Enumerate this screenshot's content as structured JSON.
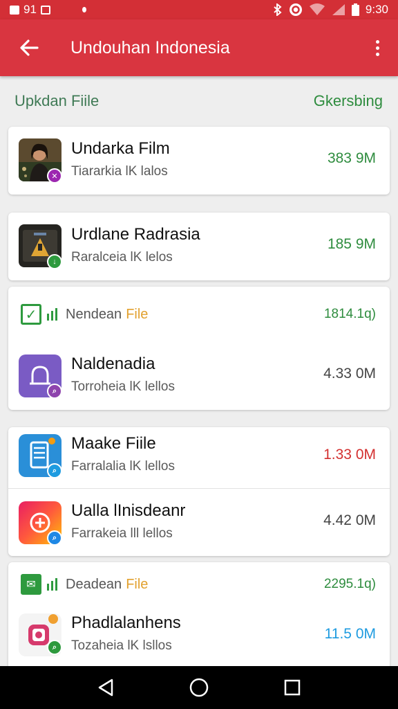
{
  "status_bar": {
    "left_text": "91",
    "time": "9:30",
    "icons": [
      "image-icon",
      "notification-dot-icon",
      "bluetooth-icon",
      "sync-icon",
      "wifi-icon",
      "signal-icon",
      "battery-icon"
    ]
  },
  "app_bar": {
    "title": "Undouhan Indonesia",
    "back_icon": "arrow-left-icon",
    "menu_icon": "more-vert-icon",
    "color": "#d93540"
  },
  "section": {
    "label": "Upkdan Fiile",
    "action": "Gkersbing"
  },
  "items": [
    {
      "name": "Undarka Film",
      "sub": "Tiararkia lK lalos",
      "size": "383 9M",
      "size_color": "#2e8c3e",
      "badge_color": "#9c27b0",
      "icon": "photo-thumbnail"
    },
    {
      "name": "Urdlane Radrasia",
      "sub": "Raralceia lK lelos",
      "size": "185 9M",
      "size_color": "#2e8c3e",
      "badge_color": "#2e9a3e",
      "icon": "video-thumbnail"
    },
    {
      "name": "Naldenadia",
      "sub": "Torroheia lK lellos",
      "size": "4.33 0M",
      "size_color": "#444444",
      "badge_color": "#8e44ad",
      "icon": "bell-app-icon"
    },
    {
      "name": "Maake Fiile",
      "sub": "Farralalia lK lellos",
      "size": "1.33 0M",
      "size_color": "#d32f2f",
      "badge_color": "#1e9be0",
      "icon": "document-app-icon"
    },
    {
      "name": "Ualla lInisdeanr",
      "sub": "Farrakeia lll lellos",
      "size": "4.42 0M",
      "size_color": "#444444",
      "badge_color": "#1e88e5",
      "icon": "gradient-app-icon"
    },
    {
      "name": "Phadlalanhens",
      "sub": "Tozaheia lK lsllos",
      "size": "11.5 0M",
      "size_color": "#1e9be0",
      "badge_color": "#2e9a3e",
      "icon": "instagram-like-icon"
    }
  ],
  "groups": [
    {
      "label": "Nendean",
      "file": "File",
      "size": "1814.1q)"
    },
    {
      "label": "Deadean",
      "file": "File",
      "size": "2295.1q)"
    }
  ],
  "nav_bar": {
    "icons": [
      "back-triangle-icon",
      "home-circle-icon",
      "recents-square-icon"
    ]
  }
}
